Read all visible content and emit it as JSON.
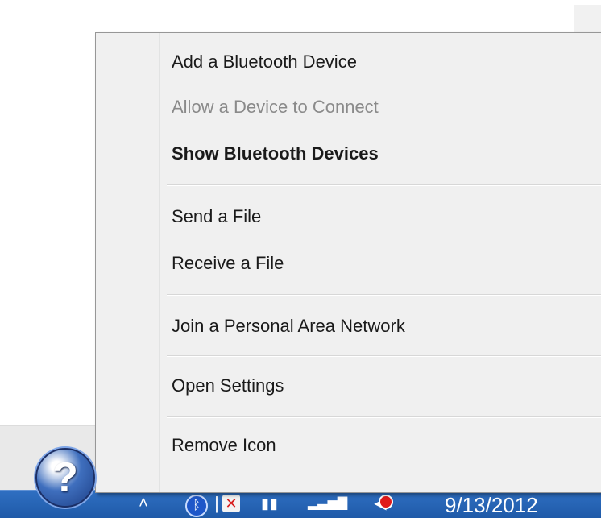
{
  "context_menu": {
    "items": [
      {
        "label": "Add a Bluetooth Device",
        "state": "enabled"
      },
      {
        "label": "Allow a Device to Connect",
        "state": "disabled"
      },
      {
        "label": "Show Bluetooth Devices",
        "state": "default"
      },
      {
        "label": "Send a File",
        "state": "enabled"
      },
      {
        "label": "Receive a File",
        "state": "enabled"
      },
      {
        "label": "Join a Personal Area Network",
        "state": "enabled"
      },
      {
        "label": "Open Settings",
        "state": "enabled"
      },
      {
        "label": "Remove Icon",
        "state": "enabled"
      }
    ]
  },
  "taskbar": {
    "clock_date": "9/13/2012",
    "help_glyph": "?",
    "tray_icons": [
      "show-hidden-icons-caret",
      "bluetooth-icon",
      "action-center-flag-icon",
      "battery-icon",
      "network-signal-icon",
      "speaker-muted-icon"
    ]
  },
  "colors": {
    "taskbar": "#2a66b8",
    "menu_background": "#f0f0f0",
    "disabled_text": "#8a8a8a"
  }
}
